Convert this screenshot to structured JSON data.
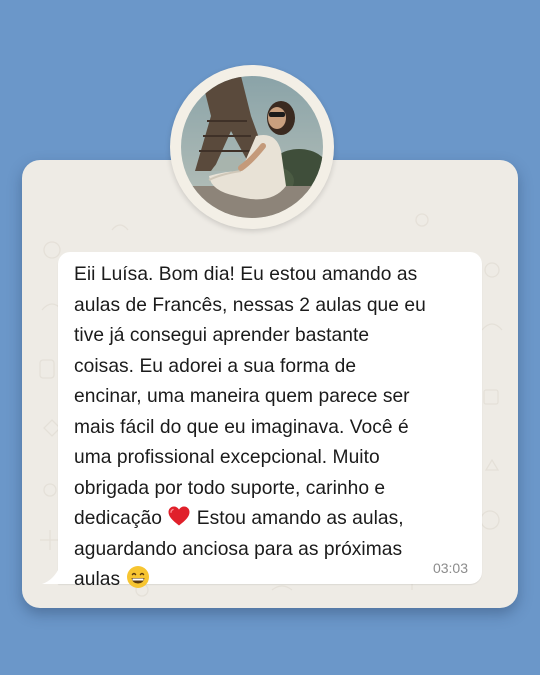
{
  "message": {
    "lines": [
      "Eii Luísa. Bom dia! Eu estou amando as",
      "aulas de Francês, nessas 2 aulas que eu",
      "tive já consegui aprender bastante",
      "coisas. Eu adorei a sua forma de",
      "encinar, uma maneira quem parece ser",
      "mais fácil do que eu imaginava. Você é",
      "uma profissional excepcional. Muito",
      "obrigada por todo suporte, carinho e",
      "dedicação",
      "Estou amando as aulas,",
      "aguardando anciosa para as próximas",
      "aulas"
    ],
    "time": "03:03"
  },
  "icons": {
    "heart": "red-heart-emoji",
    "grin": "grinning-face-emoji",
    "avatar": "profile-photo"
  },
  "colors": {
    "background": "#6b97c9",
    "card": "#eeebe5",
    "bubble": "#ffffff",
    "time": "#8c8c8c"
  }
}
